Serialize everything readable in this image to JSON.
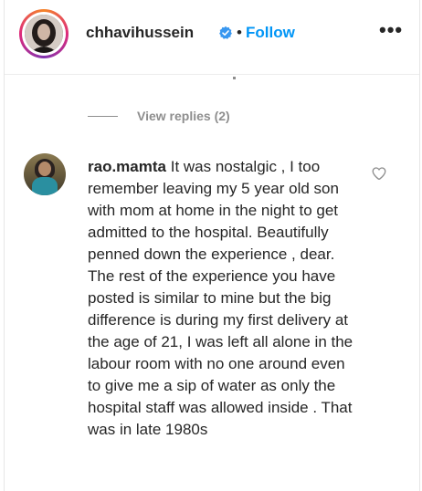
{
  "header": {
    "username": "chhavihussein",
    "separator": "•",
    "follow_label": "Follow",
    "more_label": "•••"
  },
  "replies": {
    "view_replies_label": "View replies (2)"
  },
  "comment": {
    "author": "rao.mamta",
    "text": "It was nostalgic , I too remember leaving my 5 year old son with mom at home in the night to get admitted to the hospital. Beautifully penned down the experience , dear. The rest of the experience you have posted is similar to mine but the big difference is during my first delivery at the age of 21, I was left all alone in the labour room with no one around even to give me a sip of water as only the hospital staff was allowed inside . That was in late 1980s"
  },
  "icons": {
    "verified": "verified-badge-icon",
    "more": "more-options-icon",
    "heart": "heart-outline-icon"
  },
  "colors": {
    "link_blue": "#0095f6",
    "text": "#262626",
    "muted": "#8e8e8e",
    "verified_blue": "#3897f0"
  }
}
